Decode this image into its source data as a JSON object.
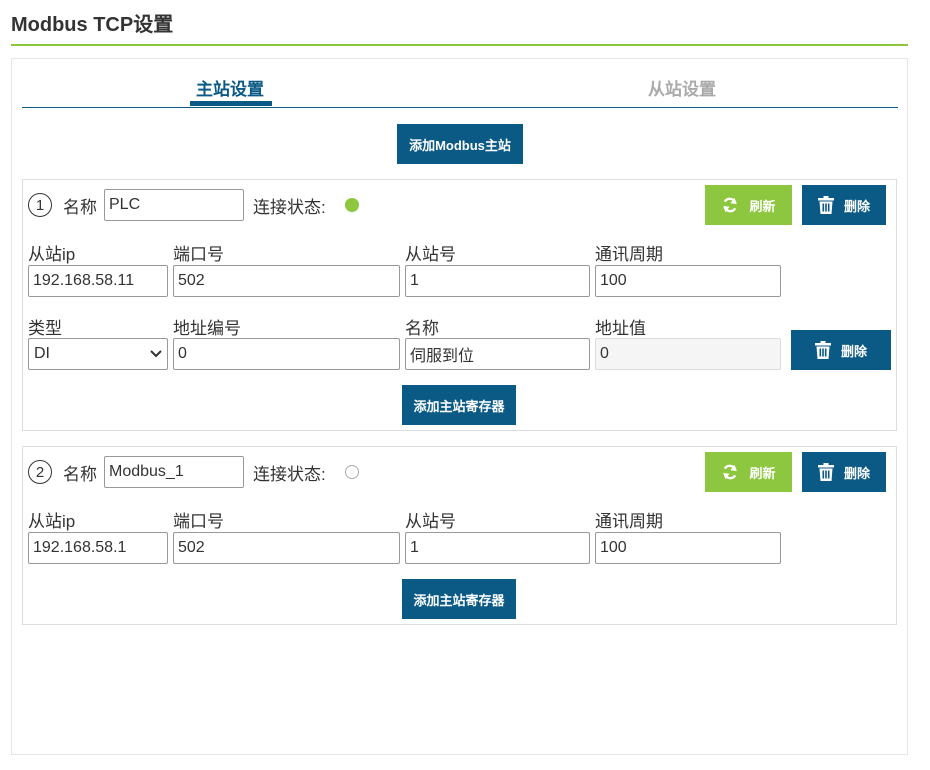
{
  "page": {
    "title": "Modbus TCP设置"
  },
  "colors": {
    "accent": "#0b5a86",
    "refresh": "#8dc63f",
    "connected": "#8dc63f"
  },
  "tabs": [
    {
      "label": "主站设置",
      "active": true
    },
    {
      "label": "从站设置",
      "active": false
    }
  ],
  "add_master_label": "添加Modbus主站",
  "masters": [
    {
      "index": "1",
      "name_label": "名称",
      "name_value": "PLC",
      "status_label": "连接状态:",
      "status": "connected",
      "refresh_label": "刷新",
      "delete_label": "删除",
      "fields": {
        "ip_label": "从站ip",
        "ip_value": "192.168.58.11",
        "port_label": "端口号",
        "port_value": "502",
        "slave_label": "从站号",
        "slave_value": "1",
        "period_label": "通讯周期",
        "period_value": "100"
      },
      "registers": [
        {
          "type_label": "类型",
          "type_value": "DI",
          "addr_label": "地址编号",
          "addr_value": "0",
          "name_label": "名称",
          "name_value": "伺服到位",
          "val_label": "地址值",
          "val_value": "0",
          "delete_label": "删除"
        }
      ],
      "add_register_label": "添加主站寄存器"
    },
    {
      "index": "2",
      "name_label": "名称",
      "name_value": "Modbus_1",
      "status_label": "连接状态:",
      "status": "disconnected",
      "refresh_label": "刷新",
      "delete_label": "删除",
      "fields": {
        "ip_label": "从站ip",
        "ip_value": "192.168.58.1",
        "port_label": "端口号",
        "port_value": "502",
        "slave_label": "从站号",
        "slave_value": "1",
        "period_label": "通讯周期",
        "period_value": "100"
      },
      "registers": [],
      "add_register_label": "添加主站寄存器"
    }
  ]
}
